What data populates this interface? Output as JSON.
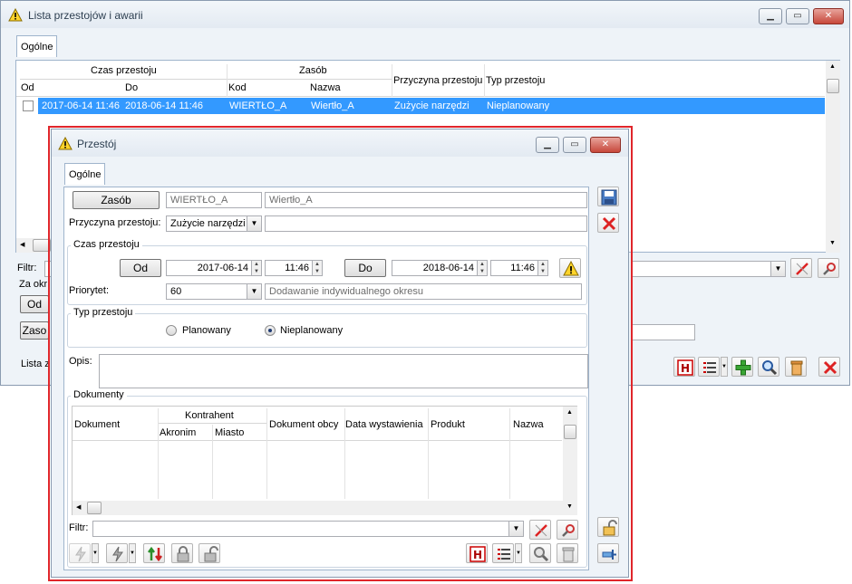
{
  "main_window": {
    "title": "Lista przestojów i awarii",
    "tab": "Ogólne",
    "table": {
      "group_headers": [
        "Czas przestoju",
        "Zasób"
      ],
      "columns": [
        "Od",
        "Do",
        "Kod",
        "Nazwa",
        "Przyczyna przestoju",
        "Typ przestoju"
      ],
      "rows": [
        {
          "od": "2017-06-14 11:46",
          "do": "2018-06-14 11:46",
          "kod": "WIERTŁO_A",
          "nazwa": "Wiertło_A",
          "przyczyna": "Zużycie narzędzi",
          "typ": "Nieplanowany"
        }
      ]
    },
    "filter_label": "Filtr:",
    "za_okres_label": "Za okr",
    "od_button": "Od",
    "zasob_button": "Zaso",
    "lista_label": "Lista z"
  },
  "dialog": {
    "title": "Przestój",
    "tab": "Ogólne",
    "zasob_button": "Zasób",
    "zasob_kod": "WIERTŁO_A",
    "zasob_nazwa": "Wiertło_A",
    "przyczyna_label": "Przyczyna przestoju:",
    "przyczyna_value": "Zużycie narzędzi",
    "czas_group": "Czas przestoju",
    "od_button": "Od",
    "od_date": "2017-06-14",
    "od_time": "11:46",
    "do_button": "Do",
    "do_date": "2018-06-14",
    "do_time": "11:46",
    "priorytet_label": "Priorytet:",
    "priorytet_value": "60",
    "priorytet_desc": "Dodawanie indywidualnego okresu",
    "typ_group": "Typ przestoju",
    "radio_planowany": "Planowany",
    "radio_nieplanowany": "Nieplanowany",
    "selected_type": "Nieplanowany",
    "opis_label": "Opis:",
    "dokumenty_group": "Dokumenty",
    "docs_table": {
      "group_header": "Kontrahent",
      "columns": [
        "Dokument",
        "Akronim",
        "Miasto",
        "Dokument obcy",
        "Data wystawienia",
        "Produkt",
        "Nazwa"
      ]
    },
    "filter_label": "Filtr:"
  },
  "colors": {
    "selection": "#3399ff",
    "highlight_border": "#e0262b",
    "warning": "#ffd42a"
  }
}
